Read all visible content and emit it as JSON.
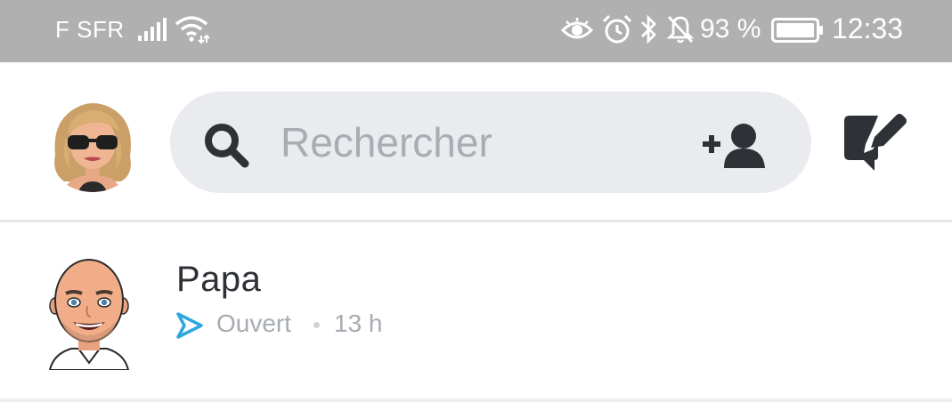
{
  "status_bar": {
    "carrier": "F SFR",
    "battery_percent": "93 %",
    "time": "12:33",
    "icons": [
      "signal-icon",
      "wifi-icon",
      "eye-icon",
      "alarm-icon",
      "bluetooth-icon",
      "notifications-off-icon",
      "battery-icon"
    ]
  },
  "header": {
    "search_placeholder": "Rechercher",
    "icons": [
      "avatar",
      "search-icon",
      "add-friend-icon",
      "new-chat-icon"
    ]
  },
  "conversations": [
    {
      "name": "Papa",
      "status": "Ouvert",
      "time": "13 h",
      "status_icon": "sent-arrow-icon"
    }
  ],
  "colors": {
    "status_bar_bg": "#b0b0b0",
    "search_bg": "#e9ebee",
    "icon_dark": "#2e3136",
    "secondary_text": "#a7acb2",
    "sent_arrow": "#2ea7e0"
  }
}
